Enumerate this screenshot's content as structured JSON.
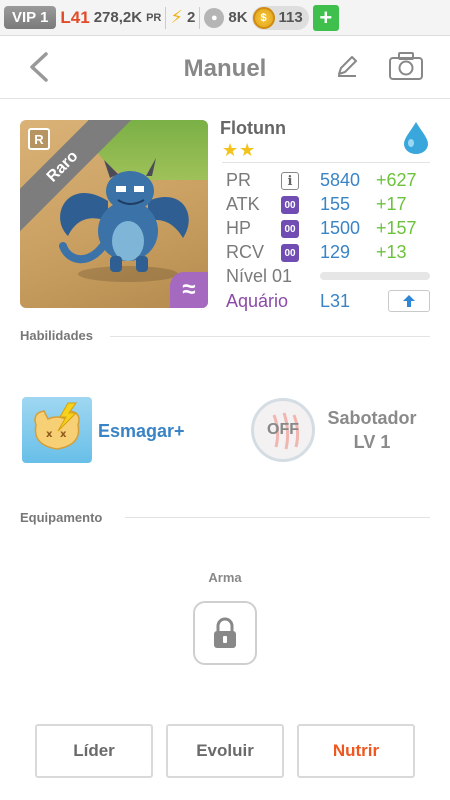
{
  "topbar": {
    "vip": "VIP 1",
    "level": "L41",
    "power": "278,2K",
    "power_unit": "PR",
    "energy": "2",
    "food": "8K",
    "gems": "113"
  },
  "header": {
    "title": "Manuel"
  },
  "monster": {
    "rarity": "Raro",
    "rarity_badge": "R",
    "element_glyph": "≈",
    "name": "Flotunn",
    "stars": "★★",
    "stats": [
      {
        "label": "PR",
        "value": "5840",
        "bonus": "+627",
        "icon": "i"
      },
      {
        "label": "ATK",
        "value": "155",
        "bonus": "+17",
        "icon": "00"
      },
      {
        "label": "HP",
        "value": "1500",
        "bonus": "+157",
        "icon": "00"
      },
      {
        "label": "RCV",
        "value": "129",
        "bonus": "+13",
        "icon": "00"
      }
    ],
    "level_label": "Nível 01",
    "level_progress": 0,
    "attribute": "Aquário",
    "level_cap": "L31"
  },
  "skills": {
    "heading": "Habilidades",
    "skill1": {
      "name": "Esmagar+"
    },
    "skill2": {
      "status": "OFF",
      "name": "Sabotador",
      "level": "LV 1"
    }
  },
  "equipment": {
    "heading": "Equipamento",
    "slot_label": "Arma"
  },
  "actions": {
    "leader": "Líder",
    "evolve": "Evoluir",
    "feed": "Nutrir"
  },
  "colors": {
    "accent_blue": "#3a84c6",
    "bonus_green": "#6cc23c",
    "attribute_purple": "#8a4aa7",
    "feed_orange": "#f0561f"
  }
}
